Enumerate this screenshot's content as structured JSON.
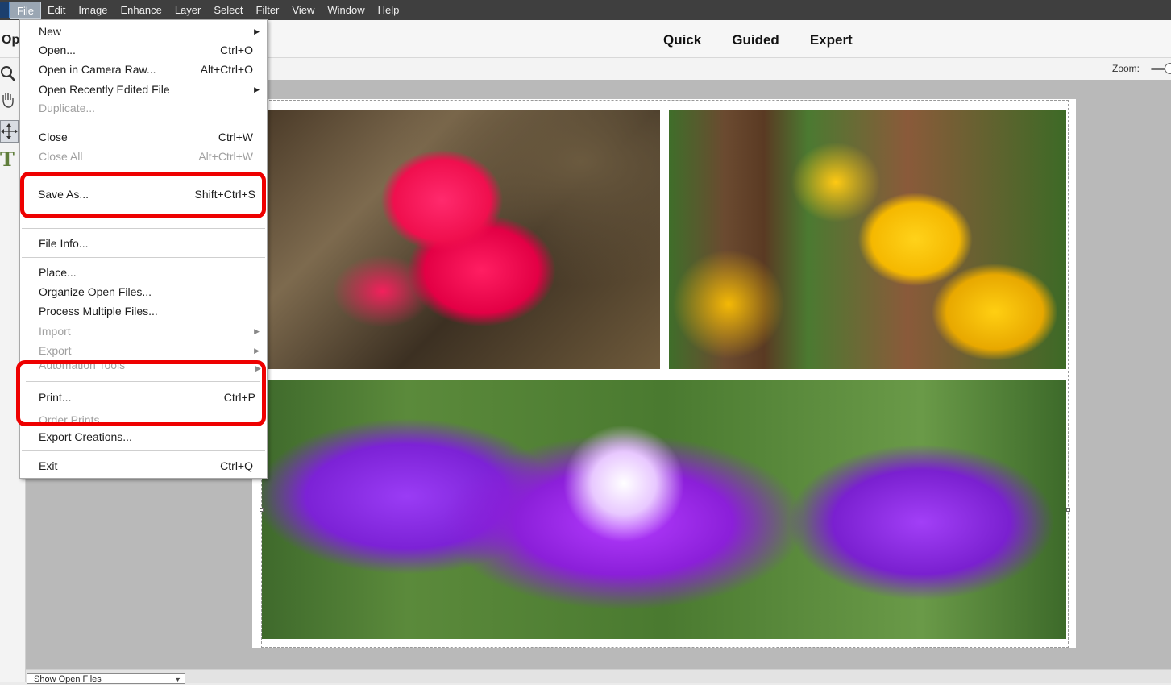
{
  "menubar": {
    "items": [
      "File",
      "Edit",
      "Image",
      "Enhance",
      "Layer",
      "Select",
      "Filter",
      "View",
      "Window",
      "Help"
    ]
  },
  "modebar": {
    "open_label": "Op",
    "tabs": [
      "Quick",
      "Guided",
      "Expert"
    ]
  },
  "options": {
    "zoom_label": "Zoom:"
  },
  "toolbar": {
    "type_tool_glyph": "T"
  },
  "file_menu": {
    "new": {
      "label": "New"
    },
    "open": {
      "label": "Open...",
      "shortcut": "Ctrl+O"
    },
    "open_camera_raw": {
      "label": "Open in Camera Raw...",
      "shortcut": "Alt+Ctrl+O"
    },
    "open_recent": {
      "label": "Open Recently Edited File"
    },
    "duplicate": {
      "label": "Duplicate..."
    },
    "close": {
      "label": "Close",
      "shortcut": "Ctrl+W"
    },
    "close_all": {
      "label": "Close All",
      "shortcut": "Alt+Ctrl+W"
    },
    "save_as": {
      "label": "Save As...",
      "shortcut": "Shift+Ctrl+S"
    },
    "file_info": {
      "label": "File Info..."
    },
    "place": {
      "label": "Place..."
    },
    "organize": {
      "label": "Organize Open Files..."
    },
    "process_multiple": {
      "label": "Process Multiple Files..."
    },
    "import": {
      "label": "Import"
    },
    "export": {
      "label": "Export"
    },
    "automation": {
      "label": "Automation Tools"
    },
    "print": {
      "label": "Print...",
      "shortcut": "Ctrl+P"
    },
    "order_prints": {
      "label": "Order Prints"
    },
    "export_creations": {
      "label": "Export Creations..."
    },
    "exit": {
      "label": "Exit",
      "shortcut": "Ctrl+Q"
    }
  },
  "bottombar": {
    "show_open_files": "Show Open Files"
  },
  "colors": {
    "highlight": "#ee0000",
    "menubar_bg": "#3f3f3f"
  }
}
